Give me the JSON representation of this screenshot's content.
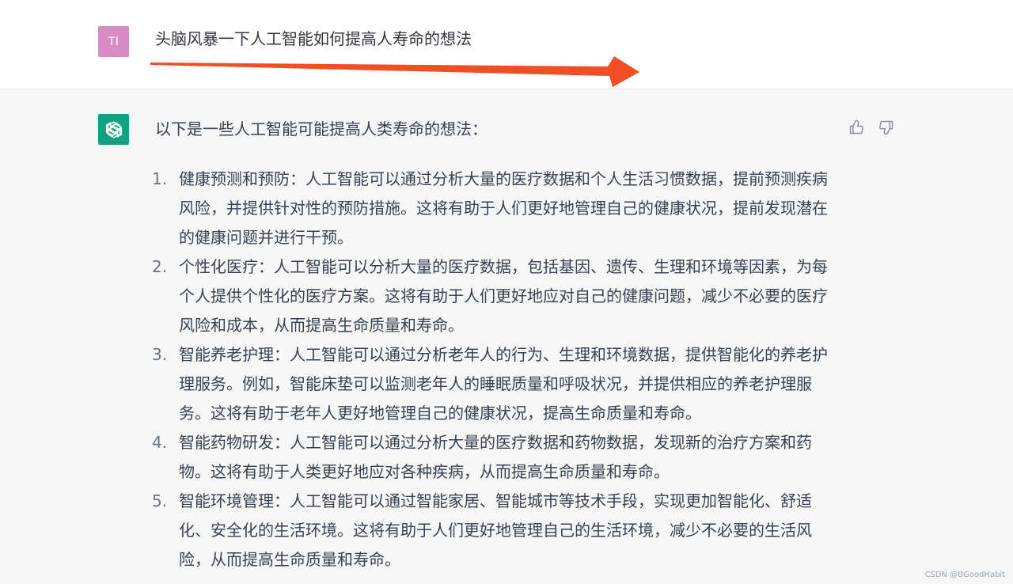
{
  "user": {
    "avatar_initials": "TI",
    "avatar_color": "#d98cc3",
    "message": "头脑风暴一下人工智能如何提高人寿命的想法"
  },
  "annotation": {
    "arrow_icon": "arrow-right-icon",
    "arrow_color": "#f04e23"
  },
  "assistant": {
    "avatar_icon": "openai-logo-icon",
    "avatar_color": "#10a37f",
    "intro": "以下是一些人工智能可能提高人类寿命的想法：",
    "items": [
      {
        "num": "1.",
        "text": "健康预测和预防：人工智能可以通过分析大量的医疗数据和个人生活习惯数据，提前预测疾病风险，并提供针对性的预防措施。这将有助于人们更好地管理自己的健康状况，提前发现潜在的健康问题并进行干预。"
      },
      {
        "num": "2.",
        "text": "个性化医疗：人工智能可以分析大量的医疗数据，包括基因、遗传、生理和环境等因素，为每个人提供个性化的医疗方案。这将有助于人们更好地应对自己的健康问题，减少不必要的医疗风险和成本，从而提高生命质量和寿命。"
      },
      {
        "num": "3.",
        "text": "智能养老护理：人工智能可以通过分析老年人的行为、生理和环境数据，提供智能化的养老护理服务。例如，智能床垫可以监测老年人的睡眠质量和呼吸状况，并提供相应的养老护理服务。这将有助于老年人更好地管理自己的健康状况，提高生命质量和寿命。"
      },
      {
        "num": "4.",
        "text": "智能药物研发：人工智能可以通过分析大量的医疗数据和药物数据，发现新的治疗方案和药物。这将有助于人类更好地应对各种疾病，从而提高生命质量和寿命。"
      },
      {
        "num": "5.",
        "text": "智能环境管理：人工智能可以通过智能家居、智能城市等技术手段，实现更加智能化、舒适化、安全化的生活环境。这将有助于人们更好地管理自己的生活环境，减少不必要的生活风险，从而提高生命质量和寿命。"
      }
    ],
    "feedback": {
      "up_icon": "thumbs-up-icon",
      "down_icon": "thumbs-down-icon"
    }
  },
  "watermark": "CSDN @BGoodHabit"
}
